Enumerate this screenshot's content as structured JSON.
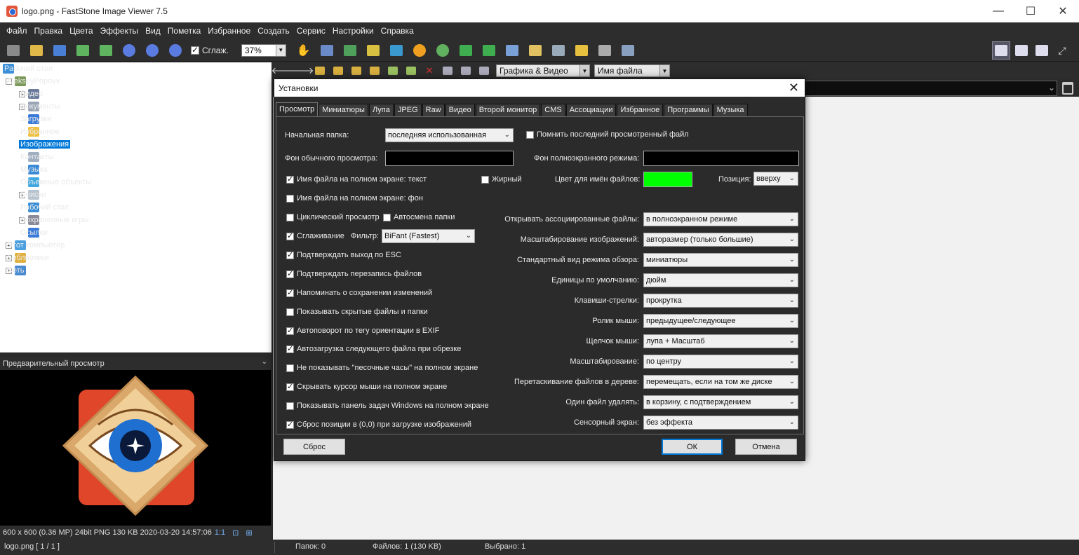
{
  "window": {
    "title": "logo.png - FastStone Image Viewer 7.5",
    "minimize": "—",
    "maximize": "☐",
    "close": "✕"
  },
  "menu": [
    "Файл",
    "Правка",
    "Цвета",
    "Эффекты",
    "Вид",
    "Пометка",
    "Избранное",
    "Создать",
    "Сервис",
    "Настройки",
    "Справка"
  ],
  "toolbar": {
    "smooth_label": "Сглаж.",
    "smooth_checked": true,
    "zoom_value": "37%"
  },
  "tree": {
    "items": [
      {
        "label": "Рабочий стол",
        "icon": "desktop-icon"
      },
      {
        "label": "AlekseyPopovv",
        "icon": "user-icon"
      },
      {
        "label": "Видео",
        "icon": "video-folder-icon"
      },
      {
        "label": "Документы",
        "icon": "documents-folder-icon"
      },
      {
        "label": "Загрузки",
        "icon": "downloads-folder-icon"
      },
      {
        "label": "Избранное",
        "icon": "star-icon"
      },
      {
        "label": "Изображения",
        "icon": "pictures-folder-icon"
      },
      {
        "label": "Контакты",
        "icon": "contacts-icon"
      },
      {
        "label": "Музыка",
        "icon": "music-icon"
      },
      {
        "label": "Объемные объекты",
        "icon": "3d-objects-icon"
      },
      {
        "label": "Поиски",
        "icon": "search-icon"
      },
      {
        "label": "Рабочий стол",
        "icon": "desktop-icon"
      },
      {
        "label": "Сохраненные игры",
        "icon": "saved-games-icon"
      },
      {
        "label": "Ссылки",
        "icon": "links-icon"
      },
      {
        "label": "Этот компьютер",
        "icon": "computer-icon"
      },
      {
        "label": "Библиотеки",
        "icon": "libraries-icon"
      },
      {
        "label": "Сеть",
        "icon": "network-icon"
      }
    ],
    "selected": "Изображения"
  },
  "preview": {
    "header": "Предварительный просмотр",
    "info": "600 x 600 (0.36 MP)  24bit  PNG    130 KB   2020-03-20 14:57:06",
    "ratio": "1:1"
  },
  "nav": {
    "filter_value": "Графика & Видео",
    "sort_value": "Имя файла"
  },
  "status": {
    "file": "logo.png [ 1 / 1 ]",
    "folders": "Папок: 0",
    "files": "Файлов: 1 (130 KB)",
    "selected": "Выбрано: 1"
  },
  "dialog": {
    "title": "Установки",
    "close": "✕",
    "tabs": [
      "Просмотр",
      "Миниатюры",
      "Лупа",
      "JPEG",
      "Raw",
      "Видео",
      "Второй монитор",
      "CMS",
      "Ассоциации",
      "Избранное",
      "Программы",
      "Музыка"
    ],
    "active_tab": "Просмотр",
    "start_folder_label": "Начальная папка:",
    "start_folder_value": "последняя использованная",
    "remember_last": {
      "label": "Помнить последний просмотренный файл",
      "checked": false
    },
    "bg_normal_label": "Фон обычного просмотра:",
    "bg_full_label": "Фон полноэкранного режима:",
    "filename_text": {
      "label": "Имя файла на полном экране: текст",
      "checked": true
    },
    "bold": {
      "label": "Жирный",
      "checked": false
    },
    "filename_color_label": "Цвет для имён файлов:",
    "position_label": "Позиция:",
    "position_value": "вверху",
    "filename_bg": {
      "label": "Имя файла на полном экране: фон",
      "checked": false
    },
    "loop": {
      "label": "Циклический просмотр",
      "checked": false
    },
    "auto_folder": {
      "label": "Автосмена папки",
      "checked": false
    },
    "smoothing": {
      "label": "Сглаживание",
      "checked": true
    },
    "filter_label": "Фильтр:",
    "filter_value": "BiFant (Fastest)",
    "left_checks": [
      {
        "label": "Подтверждать выход по ESC",
        "checked": true
      },
      {
        "label": "Подтверждать перезапись файлов",
        "checked": true
      },
      {
        "label": "Напоминать о сохранении изменений",
        "checked": true
      },
      {
        "label": "Показывать скрытые файлы и папки",
        "checked": false
      },
      {
        "label": "Автоповорот по тегу ориентации в EXIF",
        "checked": true
      },
      {
        "label": "Автозагрузка следующего файла при обрезке",
        "checked": true
      },
      {
        "label": "Не показывать \"песочные часы\" на полном экране",
        "checked": false
      },
      {
        "label": "Скрывать курсор мыши на полном экране",
        "checked": true
      },
      {
        "label": "Показывать панель задач Windows на полном экране",
        "checked": false
      },
      {
        "label": "Сброс позиции в (0,0) при загрузке изображений",
        "checked": true
      }
    ],
    "right_settings": [
      {
        "label": "Открывать ассоциированные файлы:",
        "value": "в полноэкранном режиме"
      },
      {
        "label": "Масштабирование изображений:",
        "value": "авторазмер (только большие)"
      },
      {
        "label": "Стандартный вид режима обзора:",
        "value": "миниатюры"
      },
      {
        "label": "Единицы по умолчанию:",
        "value": "дюйм"
      },
      {
        "label": "Клавиши-стрелки:",
        "value": "прокрутка"
      },
      {
        "label": "Ролик мыши:",
        "value": "предыдущее/следующее"
      },
      {
        "label": "Щелчок мыши:",
        "value": "лупа + Масштаб"
      },
      {
        "label": "Масштабирование:",
        "value": "по центру"
      },
      {
        "label": "Перетаскивание файлов в дереве:",
        "value": "перемещать, если на том же диске"
      },
      {
        "label": "Один файл удалять:",
        "value": "в корзину, с подтверждением"
      },
      {
        "label": "Сенсорный экран:",
        "value": "без эффекта"
      }
    ],
    "reset_button": "Сброс",
    "ok_button": "ОК",
    "cancel_button": "Отмена",
    "colors": {
      "bg_normal": "#000000",
      "bg_full": "#000000",
      "filename_color": "#00ff00"
    }
  }
}
